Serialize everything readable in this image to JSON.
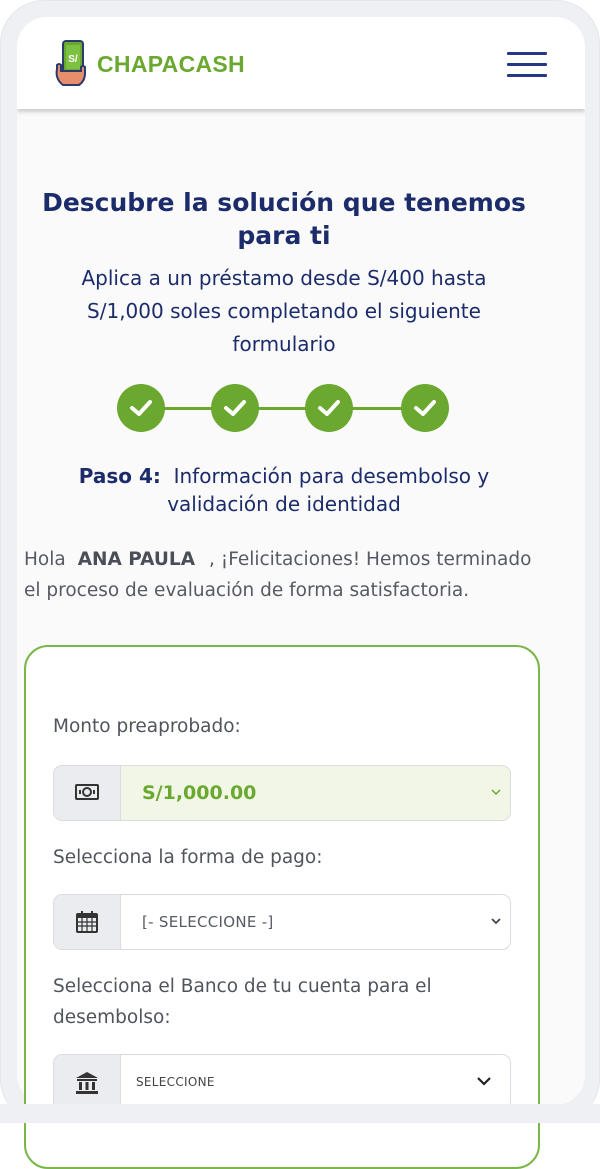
{
  "header": {
    "logo_part1": "CHAPA",
    "logo_part2": "CASH",
    "logo_badge": "S/",
    "menu_icon": "hamburger-menu-icon"
  },
  "hero": {
    "title": "Descubre la solución que tenemos para ti",
    "subtitle": "Aplica a un préstamo desde S/400 hasta S/1,000 soles completando el siguiente formulario"
  },
  "steps": {
    "total": 4,
    "completed": 4,
    "icon": "check-icon",
    "current_label": "Paso 4:",
    "current_title": "Información para desembolso y validación de identidad"
  },
  "greeting": {
    "hello": "Hola",
    "name": "ANA PAULA",
    "message": ", ¡Felicitaciones! Hemos terminado el proceso de evaluación de forma satisfactoria."
  },
  "form": {
    "amount_label": "Monto preaprobado:",
    "amount_value": "S/1,000.00",
    "amount_icon": "money-bill-icon",
    "payment_label": "Selecciona la forma de pago:",
    "payment_value": "[- SELECCIONE -]",
    "payment_icon": "calendar-icon",
    "bank_label": "Selecciona el Banco de tu cuenta para el desembolso:",
    "bank_value": "SELECCIONE",
    "bank_icon": "bank-icon"
  },
  "colors": {
    "brand_green": "#6aa830",
    "brand_navy": "#1c2c6b",
    "menu_navy": "#263783"
  }
}
